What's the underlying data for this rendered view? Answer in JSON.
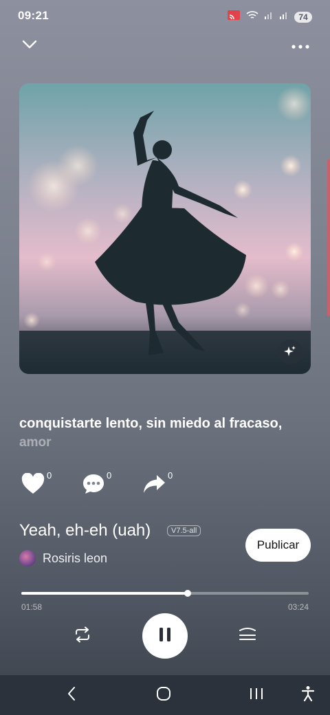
{
  "status_bar": {
    "time": "09:21",
    "battery": "74",
    "icons": [
      "cast-icon",
      "wifi-icon",
      "signal-icon",
      "signal-icon",
      "battery-icon"
    ]
  },
  "top_bar": {
    "collapse_icon": "chevron-down-icon",
    "menu_icon": "more-horizontal-icon"
  },
  "artwork": {
    "description_icon": "sparkle-icon"
  },
  "lyrics": {
    "current": "conquistarte lento, sin miedo al fracaso,",
    "next": "amor"
  },
  "actions": [
    {
      "icon": "heart-icon",
      "count": "0"
    },
    {
      "icon": "comment-icon",
      "count": "0"
    },
    {
      "icon": "share-icon",
      "count": "0"
    }
  ],
  "song": {
    "title": "Yeah, eh-eh (uah)",
    "version": "V7.5-all",
    "artist": "Rosiris leon"
  },
  "publish_label": "Publicar",
  "player": {
    "elapsed": "01:58",
    "total": "03:24",
    "progress": 0.58
  },
  "colors": {
    "accent": "#ffffff",
    "background_top": "#8d909e",
    "background_bottom": "#39404a",
    "navbar": "#2c323b"
  }
}
